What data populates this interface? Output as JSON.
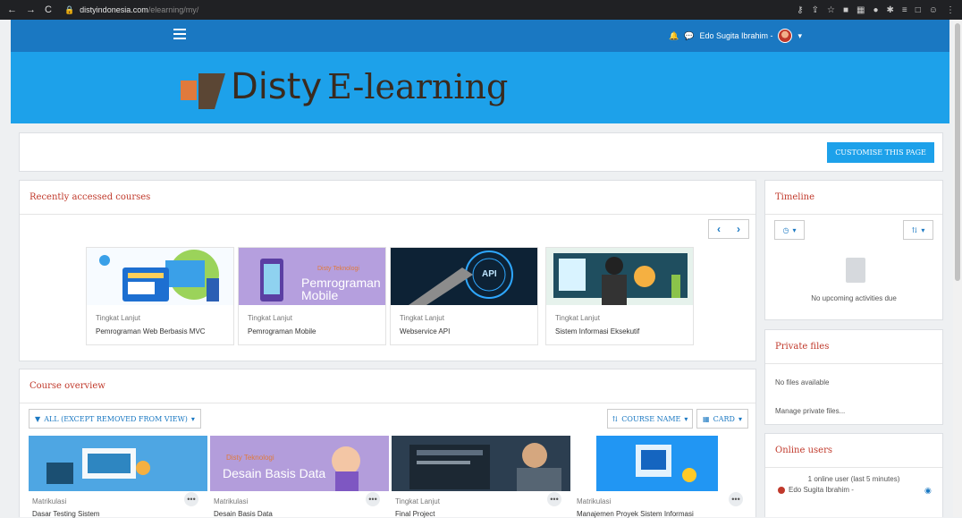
{
  "browser": {
    "host": "distyindonesia.com",
    "path": "/elearning/my/"
  },
  "navbar": {
    "user_name": "Edo Sugita Ibrahim -"
  },
  "brand": {
    "word1": "Disty",
    "word2": "E-learning",
    "colors": {
      "banner": "#1da1ea",
      "navbar": "#1a78c2",
      "heading": "#c0392b"
    }
  },
  "page": {
    "customise_label": "CUSTOMISE THIS PAGE"
  },
  "recent": {
    "title": "Recently accessed courses",
    "courses": [
      {
        "category": "Tingkat Lanjut",
        "name": "Pemrograman Web Berbasis MVC"
      },
      {
        "category": "Tingkat Lanjut",
        "name": "Pemrograman Mobile",
        "image_text": "Pemrograman Mobile",
        "image_brand": "Disty Teknologi"
      },
      {
        "category": "Tingkat Lanjut",
        "name": "Webservice API",
        "image_text": "API"
      },
      {
        "category": "Tingkat Lanjut",
        "name": "Sistem Informasi Eksekutif"
      }
    ]
  },
  "overview": {
    "title": "Course overview",
    "filter_label": "ALL (EXCEPT REMOVED FROM VIEW)",
    "sort_label": "COURSE NAME",
    "view_label": "CARD",
    "courses": [
      {
        "category": "Matrikulasi",
        "name": "Dasar Testing Sistem"
      },
      {
        "category": "Matrikulasi",
        "name": "Desain Basis Data",
        "image_text": "Desain Basis Data",
        "image_brand": "Disty Teknologi"
      },
      {
        "category": "Tingkat Lanjut",
        "name": "Final Project"
      },
      {
        "category": "Matrikulasi",
        "name": "Manajemen Proyek Sistem Informasi"
      }
    ]
  },
  "timeline": {
    "title": "Timeline",
    "empty_text": "No upcoming activities due"
  },
  "private_files": {
    "title": "Private files",
    "empty_text": "No files available",
    "manage_link": "Manage private files..."
  },
  "online_users": {
    "title": "Online users",
    "summary": "1 online user (last 5 minutes)",
    "user": "Edo Sugita Ibrahim -"
  }
}
